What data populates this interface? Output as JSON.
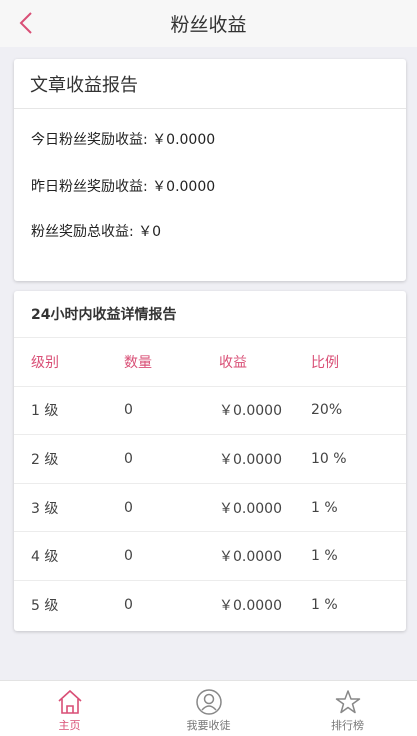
{
  "header": {
    "title": "粉丝收益"
  },
  "summary": {
    "title": "文章收益报告",
    "today": "今日粉丝奖励收益: ￥0.0000",
    "yesterday": "昨日粉丝奖励收益: ￥0.0000",
    "total": "粉丝奖励总收益: ￥0"
  },
  "report": {
    "title": "24小时内收益详情报告",
    "columns": [
      "级别",
      "数量",
      "收益",
      "比例"
    ],
    "rows": [
      [
        "1 级",
        "0",
        "￥0.0000",
        "20%"
      ],
      [
        "2 级",
        "0",
        "￥0.0000",
        "10 %"
      ],
      [
        "3 级",
        "0",
        "￥0.0000",
        "1 %"
      ],
      [
        "4 级",
        "0",
        "￥0.0000",
        "1 %"
      ],
      [
        "5 级",
        "0",
        "￥0.0000",
        "1 %"
      ]
    ]
  },
  "tabbar": {
    "items": [
      {
        "label": "主页",
        "icon": "home-icon"
      },
      {
        "label": "我要收徒",
        "icon": "user-icon"
      },
      {
        "label": "排行榜",
        "icon": "star-icon"
      }
    ]
  },
  "colors": {
    "accent": "#d94f76",
    "background": "#efeff4"
  }
}
